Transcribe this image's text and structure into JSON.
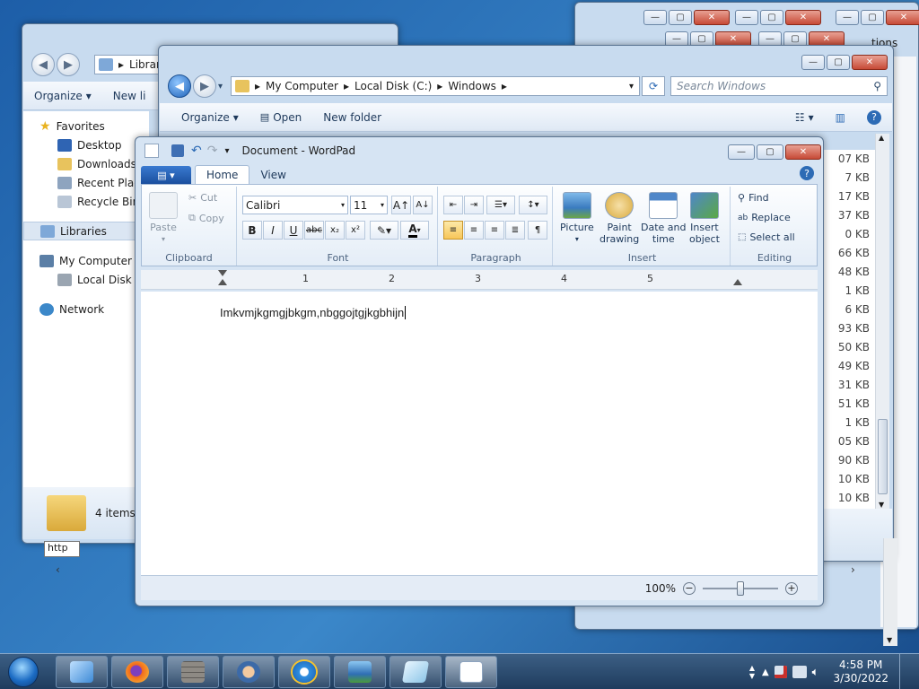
{
  "back_explorer": {
    "address_crumb": "Librari",
    "organize": "Organize",
    "new_library": "New li",
    "nav": {
      "favorites": "Favorites",
      "desktop": "Desktop",
      "downloads": "Downloads",
      "recent": "Recent Place",
      "recycle": "Recycle Bin",
      "libraries": "Libraries",
      "my_computer": "My Computer",
      "local_disk": "Local Disk (C",
      "network": "Network"
    },
    "status_count": "4 items",
    "tooltip": "http"
  },
  "windows_explorer": {
    "address": {
      "crumb1": "My Computer",
      "crumb2": "Local Disk (C:)",
      "crumb3": "Windows"
    },
    "search_placeholder": "Search Windows",
    "organize": "Organize",
    "open": "Open",
    "new_folder": "New folder",
    "sizes": [
      "07 KB",
      "7 KB",
      "17 KB",
      "37 KB",
      "0 KB",
      "66 KB",
      "48 KB",
      "1 KB",
      "6 KB",
      "93 KB",
      "50 KB",
      "49 KB",
      "31 KB",
      "51 KB",
      "1 KB",
      "05 KB",
      "90 KB",
      "10 KB",
      "10 KB"
    ]
  },
  "back_window_partial": {
    "label": "tions"
  },
  "wordpad": {
    "title": "Document - WordPad",
    "tabs": {
      "home": "Home",
      "view": "View"
    },
    "clipboard": {
      "paste": "Paste",
      "cut": "Cut",
      "copy": "Copy",
      "group": "Clipboard"
    },
    "font": {
      "family": "Calibri",
      "size": "11",
      "group": "Font",
      "bold": "B",
      "italic": "I",
      "underline": "U",
      "strike": "abc",
      "sub": "x₂",
      "sup": "x²",
      "color": "A"
    },
    "paragraph": {
      "group": "Paragraph"
    },
    "insert": {
      "picture": "Picture",
      "paint1": "Paint",
      "paint2": "drawing",
      "date1": "Date and",
      "date2": "time",
      "obj1": "Insert",
      "obj2": "object",
      "group": "Insert"
    },
    "editing": {
      "find": "Find",
      "replace": "Replace",
      "select_all": "Select all",
      "group": "Editing"
    },
    "ruler": [
      "1",
      "2",
      "3",
      "4",
      "5"
    ],
    "document_text": "Imkvmjkgmgjbkgm,nbggojtgjkgbhijn",
    "zoom": "100%"
  },
  "taskbar": {
    "time": "4:58 PM",
    "date": "3/30/2022"
  },
  "colors": {
    "accent": "#1e62b8",
    "ribbon": "#dfe9f5"
  }
}
